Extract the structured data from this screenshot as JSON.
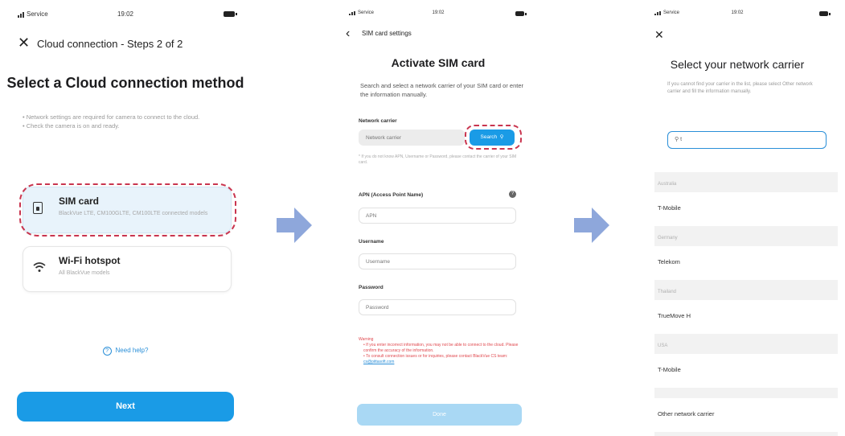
{
  "screen1": {
    "status": {
      "carrier": "Service",
      "time": "19:02"
    },
    "nav_title": "Cloud connection - Steps 2 of 2",
    "heading": "Select a Cloud connection method",
    "notes": [
      "Network settings are required for camera to connect to the cloud.",
      "Check the camera is on and ready."
    ],
    "options": [
      {
        "title": "SIM card",
        "subtitle": "BlackVue LTE, CM100GLTE, CM100LTE connected models",
        "icon": "sim-card-icon"
      },
      {
        "title": "Wi-Fi hotspot",
        "subtitle": "All BlackVue models",
        "icon": "wifi-icon"
      }
    ],
    "help_label": "Need help?",
    "next_label": "Next"
  },
  "screen2": {
    "status": {
      "carrier": "Service",
      "time": "19:02"
    },
    "nav_title": "SIM card settings",
    "heading": "Activate SIM card",
    "description": "Search and select a network carrier of your SIM card or enter the information manually.",
    "carrier_label": "Network carrier",
    "carrier_placeholder": "Network carrier",
    "search_label": "Search",
    "hint": "* If you do not know APN, Username or Password, please contact the carrier of your SIM card.",
    "apn_label": "APN (Access Point Name)",
    "apn_placeholder": "APN",
    "username_label": "Username",
    "username_placeholder": "Username",
    "password_label": "Password",
    "password_placeholder": "Password",
    "warning_title": "Warning",
    "warning_items": [
      "If you enter incorrect information, you may not be able to connect to the cloud. Please confirm the accuracy of the information.",
      "To consult connection issues or for inquiries, please contact BlackVue CS team:"
    ],
    "warning_link": "cs@pittasoft.com",
    "done_label": "Done"
  },
  "screen3": {
    "status": {
      "carrier": "Service",
      "time": "19:02"
    },
    "heading": "Select your network carrier",
    "description": "If you cannot find your carrier in the list, please select Other network carrier and fill the information manually.",
    "search_value": "t",
    "groups": [
      {
        "country": "Australia",
        "carrier": "T-Mobile"
      },
      {
        "country": "Germany",
        "carrier": "Telekom"
      },
      {
        "country": "Thailand",
        "carrier": "TrueMove H"
      },
      {
        "country": "USA",
        "carrier": "T-Mobile"
      }
    ],
    "other_label": "Other network carrier"
  },
  "colors": {
    "accent": "#1a9be6",
    "highlight_dash": "#c9354f",
    "arrow": "#8ea7db",
    "warning": "#e0484e"
  }
}
